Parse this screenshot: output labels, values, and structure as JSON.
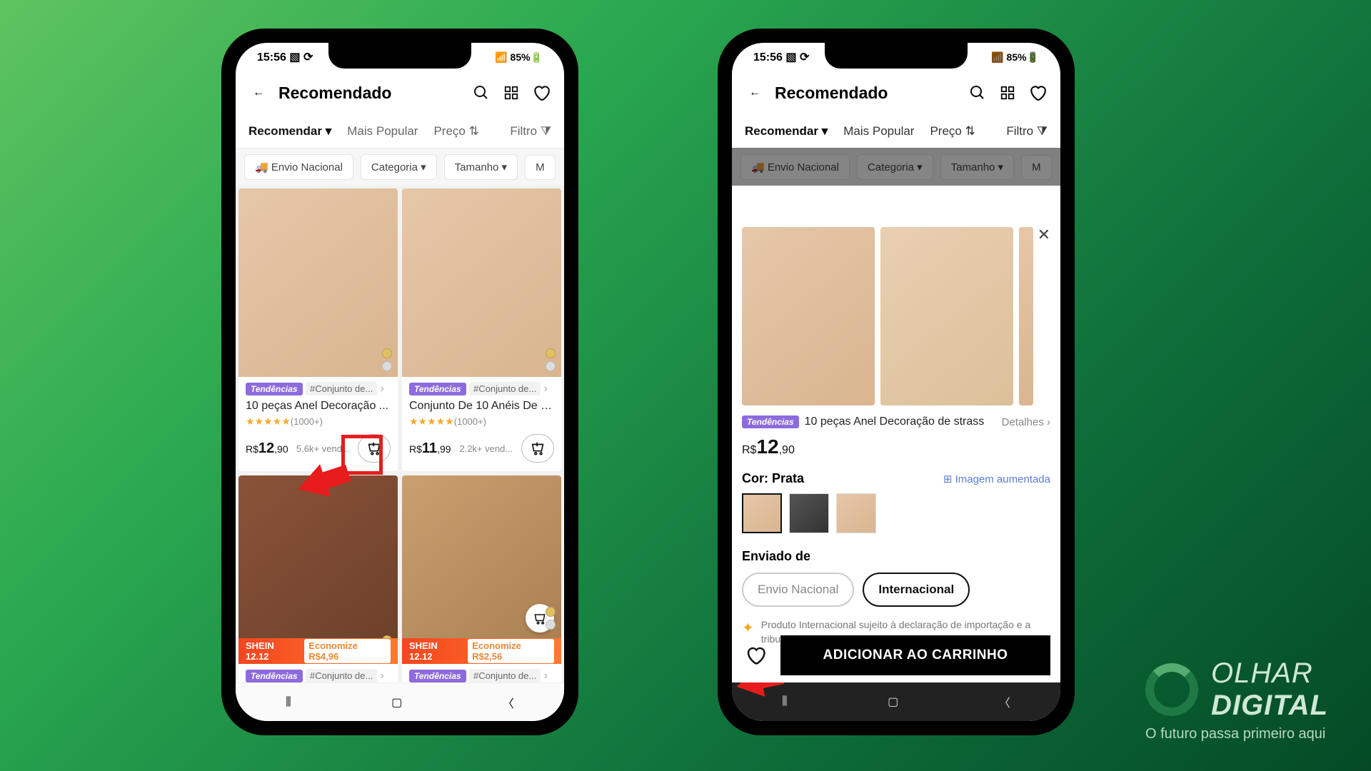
{
  "status": {
    "time": "15:56",
    "icons": "▧ ⟳",
    "battery": "85%",
    "sig": "📶"
  },
  "header": {
    "title": "Recomendado"
  },
  "tabs": {
    "recommend": "Recomendar",
    "popular": "Mais Popular",
    "price": "Preço",
    "filter": "Filtro"
  },
  "chips": {
    "ship": "Envio Nacional",
    "cat": "Categoria",
    "size": "Tamanho",
    "more": "M"
  },
  "products": [
    {
      "trend": "Tendências",
      "tag": "#Conjunto de...",
      "name": "10 peças Anel Decoração ...",
      "reviews": "(1000+)",
      "currency": "R$",
      "price_int": "12",
      "price_dec": ",90",
      "sold": "5.6k+ vend..."
    },
    {
      "trend": "Tendências",
      "tag": "#Conjunto de...",
      "name": "Conjunto De 10 Anéis De D...",
      "reviews": "(1000+)",
      "currency": "R$",
      "price_int": "11",
      "price_dec": ",99",
      "sold": "2.2k+ vend..."
    },
    {
      "trend": "Tendências",
      "tag": "#Conjunto de...",
      "sale_brand": "SHEIN 12.12",
      "sale_text": "Economize R$4,96"
    },
    {
      "trend": "Tendências",
      "tag": "#Conjunto de...",
      "sale_brand": "SHEIN 12.12",
      "sale_text": "Economize R$2,56"
    }
  ],
  "modal": {
    "trend": "Tendências",
    "name": "10 peças Anel Decoração de strass",
    "details": "Detalhes",
    "currency": "R$",
    "price_int": "12",
    "price_dec": ",90",
    "color_label": "Cor: Prata",
    "zoom": "Imagem aumentada",
    "ship_label": "Enviado de",
    "ship_national": "Envio Nacional",
    "ship_intl": "Internacional",
    "note": "Produto Internacional sujeito à declaração de importação e a tributos estaduais e federais.",
    "add": "ADICIONAR AO CARRINHO"
  },
  "brand": {
    "name": "OLHAR DIGITAL",
    "tagline": "O futuro passa primeiro aqui"
  }
}
